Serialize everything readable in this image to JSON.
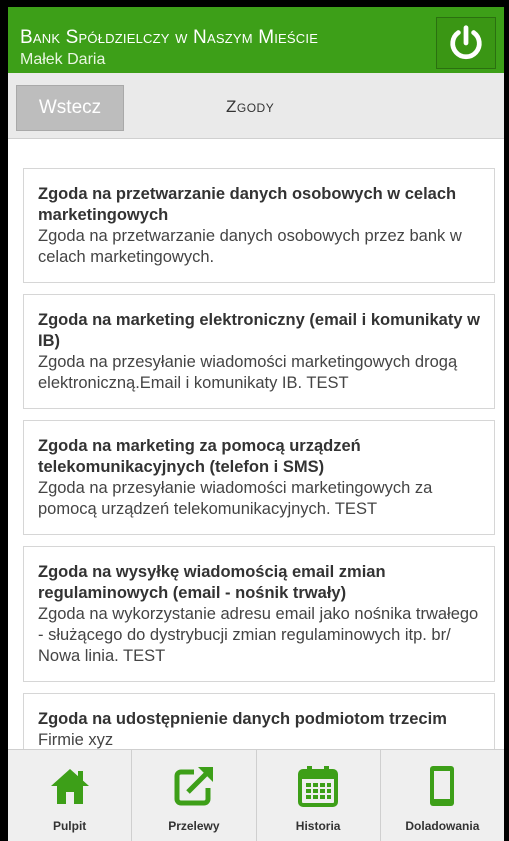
{
  "header": {
    "bank_name": "Bank Spółdzielczy w Naszym Mieście",
    "user_name": "Małek Daria",
    "power_icon": "power-icon"
  },
  "toolbar": {
    "back_label": "Wstecz",
    "title": "Zgody"
  },
  "consents": [
    {
      "title": "Zgoda na przetwarzanie danych osobowych w celach marketingowych",
      "desc": "Zgoda na przetwarzanie danych osobowych przez bank w celach marketingowych."
    },
    {
      "title": "Zgoda na marketing elektroniczny (email i komunikaty w IB)",
      "desc": "Zgoda na przesyłanie wiadomości marketingowych drogą elektroniczną.Email i komunikaty IB. TEST"
    },
    {
      "title": "Zgoda na marketing za pomocą urządzeń telekomunikacyjnych (telefon i SMS)",
      "desc": "Zgoda na przesyłanie wiadomości marketingowych za pomocą urządzeń telekomunikacyjnych. TEST"
    },
    {
      "title": "Zgoda na wysyłkę wiadomością email zmian regulaminowych (email - nośnik trwały)",
      "desc": "Zgoda na wykorzystanie adresu email jako nośnika trwałego - służącego do dystrybucji zmian regulaminowych itp. br/ Nowa linia. TEST"
    },
    {
      "title": "Zgoda na udostępnienie danych podmiotom trzecim",
      "desc": "Firmie xyz"
    }
  ],
  "bottom_nav": [
    {
      "label": "Pulpit",
      "icon": "home-icon"
    },
    {
      "label": "Przelewy",
      "icon": "transfer-icon"
    },
    {
      "label": "Historia",
      "icon": "calendar-icon"
    },
    {
      "label": "Doladowania",
      "icon": "phone-icon"
    }
  ],
  "colors": {
    "brand_green": "#3d9f18",
    "nav_icon_green": "#3d9f18"
  }
}
